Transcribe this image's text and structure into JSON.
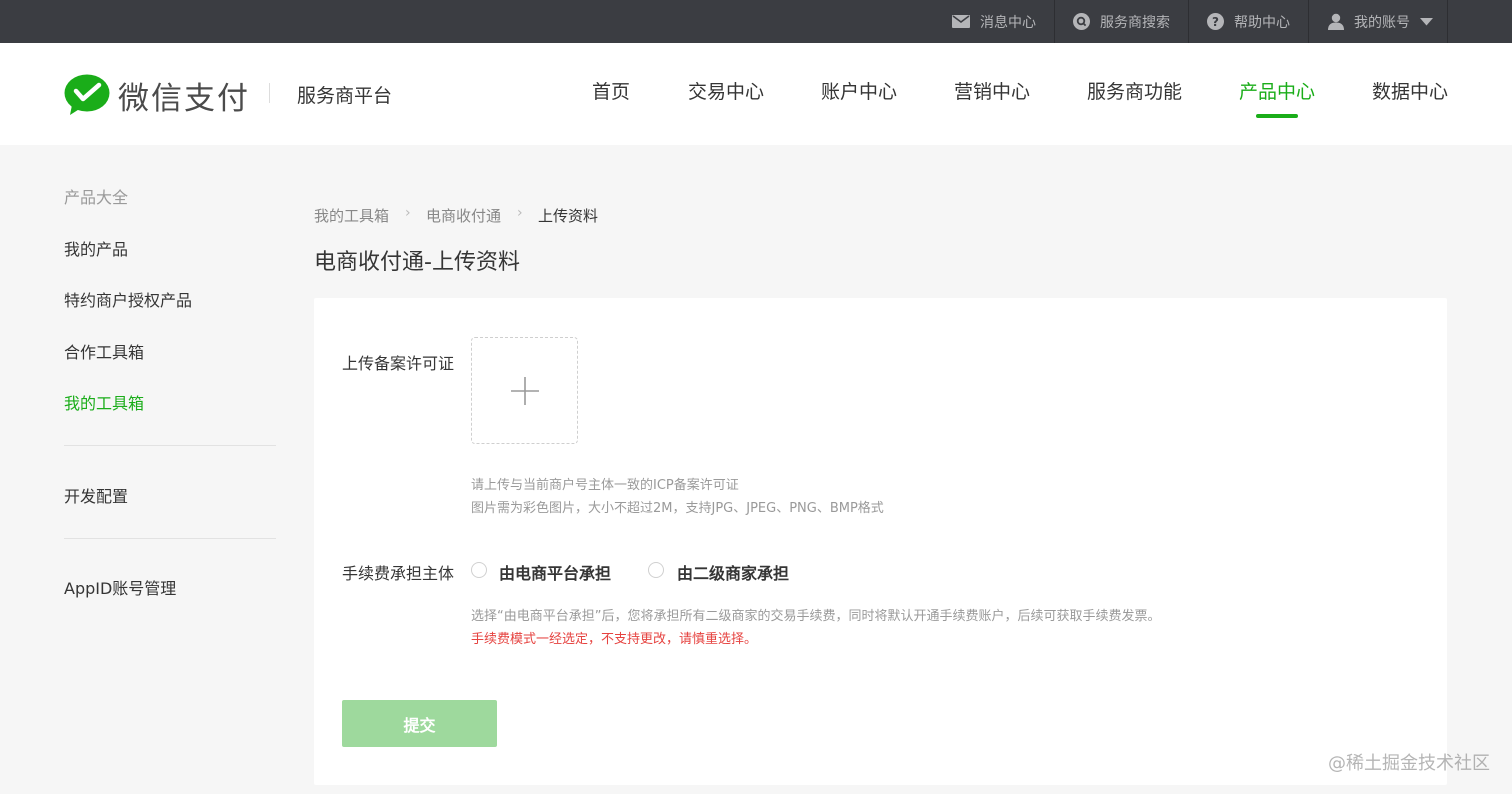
{
  "topbar": {
    "messages": "消息中心",
    "search": "服务商搜索",
    "help": "帮助中心",
    "account": "我的账号"
  },
  "header": {
    "logo_text": "微信支付",
    "platform": "服务商平台",
    "nav": [
      "首页",
      "交易中心",
      "账户中心",
      "营销中心",
      "服务商功能",
      "产品中心",
      "数据中心"
    ],
    "active_nav": "产品中心"
  },
  "sidebar": {
    "category": "产品大全",
    "items": [
      "我的产品",
      "特约商户授权产品",
      "合作工具箱",
      "我的工具箱"
    ],
    "active_item": "我的工具箱",
    "dev_config": "开发配置",
    "appid": "AppID账号管理"
  },
  "breadcrumb": [
    "我的工具箱",
    "电商收付通",
    "上传资料"
  ],
  "page_title": "电商收付通-上传资料",
  "form": {
    "upload_label": "上传备案许可证",
    "upload_hint_1": "请上传与当前商户号主体一致的ICP备案许可证",
    "upload_hint_2": "图片需为彩色图片，大小不超过2M，支持JPG、JPEG、PNG、BMP格式",
    "fee_label": "手续费承担主体",
    "fee_options": [
      "由电商平台承担",
      "由二级商家承担"
    ],
    "fee_hint": "选择“由电商平台承担”后，您将承担所有二级商家的交易手续费，同时将默认开通手续费账户，后续可获取手续费发票。",
    "fee_warning": "手续费模式一经选定，不支持更改，请慎重选择。",
    "submit": "提交"
  },
  "watermark": "@稀土掘金技术社区",
  "colors": {
    "accent": "#1aad19",
    "topbar": "#3b3d42",
    "warning": "#e64340",
    "button_disabled": "#9ed99d"
  }
}
